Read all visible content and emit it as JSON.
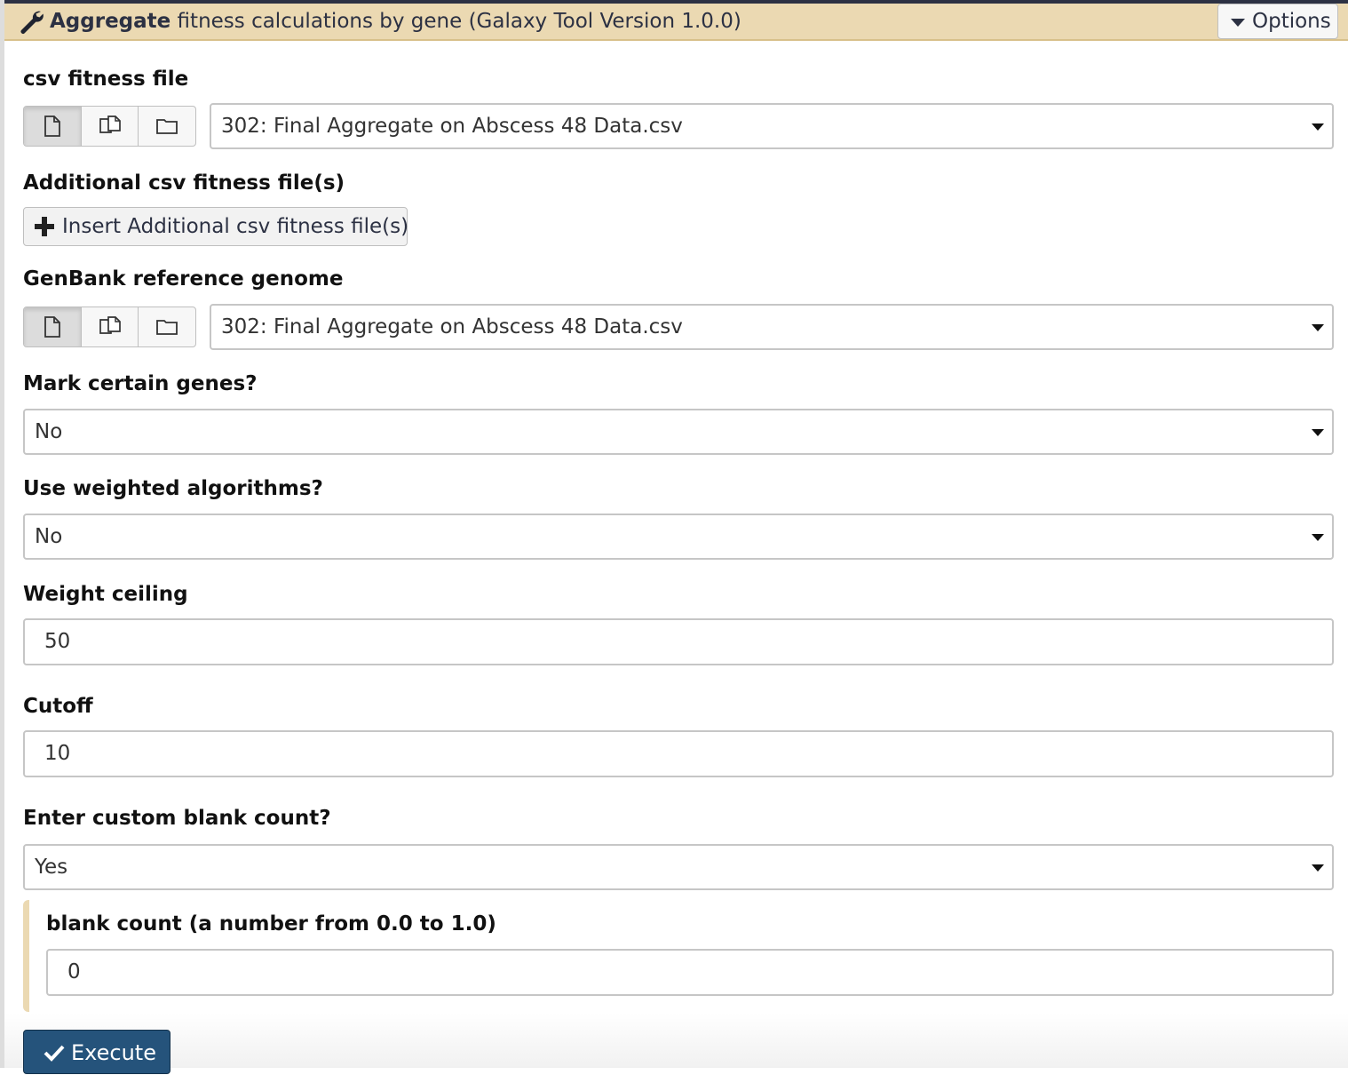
{
  "header": {
    "title_bold": "Aggregate",
    "title_rest": " fitness calculations by gene (Galaxy Tool Version 1.0.0)",
    "options_label": "Options"
  },
  "form": {
    "csv_fitness_file": {
      "label": "csv fitness file",
      "value": "302: Final Aggregate on Abscess 48 Data.csv"
    },
    "additional_csv": {
      "label": "Additional csv fitness file(s)",
      "insert_button": "Insert Additional csv fitness file(s)"
    },
    "genbank_reference": {
      "label": "GenBank reference genome",
      "value": "302: Final Aggregate on Abscess 48 Data.csv"
    },
    "mark_certain_genes": {
      "label": "Mark certain genes?",
      "value": "No"
    },
    "use_weighted_algorithms": {
      "label": "Use weighted algorithms?",
      "value": "No"
    },
    "weight_ceiling": {
      "label": "Weight ceiling",
      "value": "50"
    },
    "cutoff": {
      "label": "Cutoff",
      "value": "10"
    },
    "custom_blank_count": {
      "label": "Enter custom blank count?",
      "value": "Yes"
    },
    "blank_count": {
      "label": "blank count (a number from 0.0 to 1.0)",
      "value": "0"
    }
  },
  "execute_label": "Execute",
  "colors": {
    "header_bg": "#ebd9b2",
    "execute_bg": "#25537b",
    "border": "#c6c6c6"
  },
  "icons": [
    "wrench-icon",
    "caret-down-icon",
    "single-dataset-icon",
    "multiple-datasets-icon",
    "dataset-collection-icon",
    "plus-icon",
    "check-icon"
  ]
}
